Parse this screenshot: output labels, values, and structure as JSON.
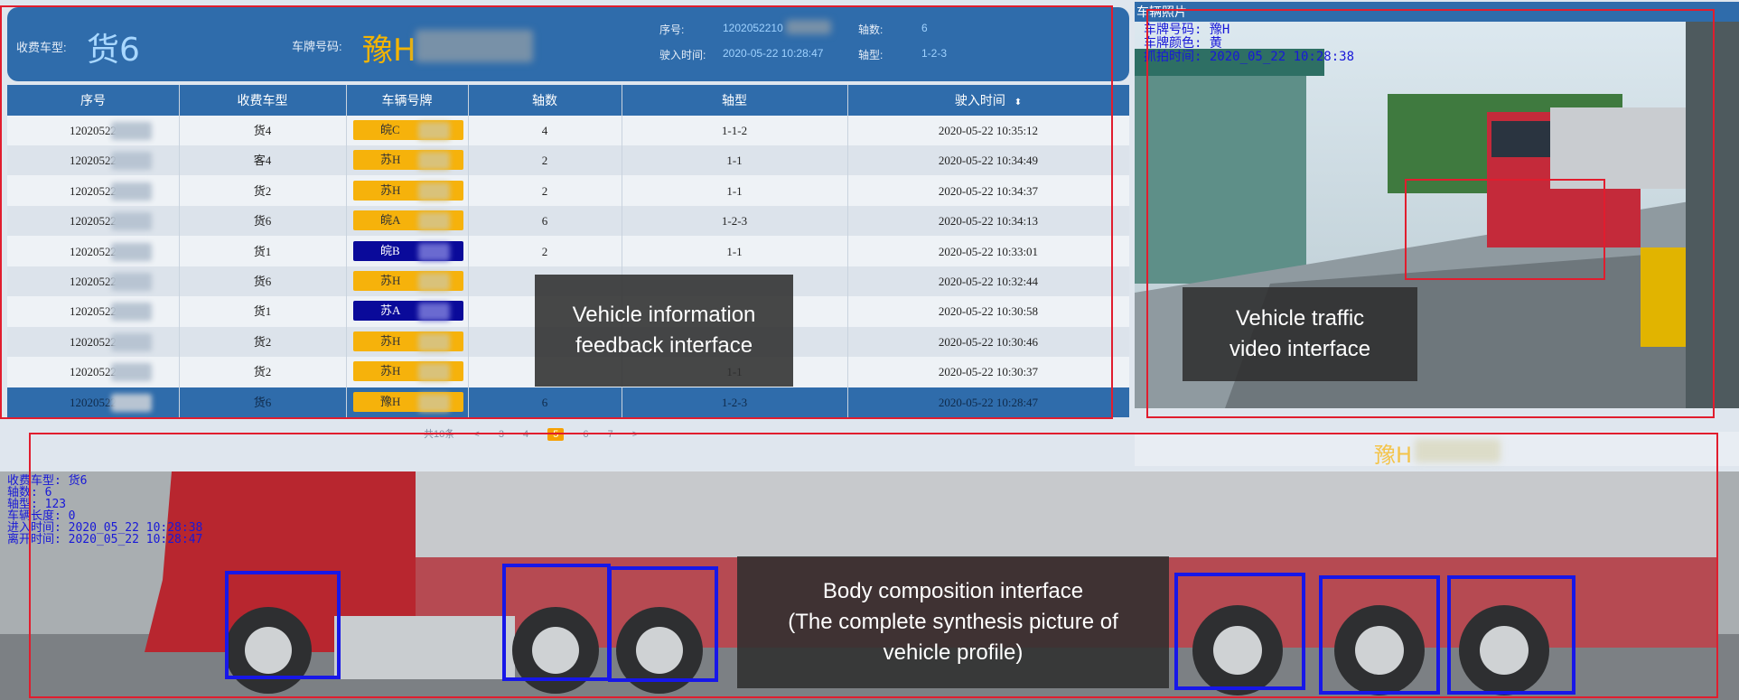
{
  "header": {
    "toll_type_label": "收费车型:",
    "toll_type_value": "货6",
    "plate_label": "车牌号码:",
    "plate_value": "豫H",
    "seq_label": "序号:",
    "seq_value": "1202052210",
    "axles_label": "轴数:",
    "axles_value": "6",
    "entry_time_label": "驶入时间:",
    "entry_time_value": "2020-05-22 10:28:47",
    "axle_type_label": "轴型:",
    "axle_type_value": "1-2-3"
  },
  "table": {
    "columns": [
      "序号",
      "收费车型",
      "车辆号牌",
      "轴数",
      "轴型",
      "驶入时间"
    ],
    "sort_icon": "sort-updown-icon",
    "rows": [
      {
        "seq": "12020522",
        "type": "货4",
        "plate": "皖C",
        "plate_color": "yellow",
        "axles": "4",
        "axle_type": "1-1-2",
        "time": "2020-05-22 10:35:12"
      },
      {
        "seq": "12020522",
        "type": "客4",
        "plate": "苏H",
        "plate_color": "yellow",
        "axles": "2",
        "axle_type": "1-1",
        "time": "2020-05-22 10:34:49"
      },
      {
        "seq": "12020522",
        "type": "货2",
        "plate": "苏H",
        "plate_color": "yellow",
        "axles": "2",
        "axle_type": "1-1",
        "time": "2020-05-22 10:34:37"
      },
      {
        "seq": "12020522",
        "type": "货6",
        "plate": "皖A",
        "plate_color": "yellow",
        "axles": "6",
        "axle_type": "1-2-3",
        "time": "2020-05-22 10:34:13"
      },
      {
        "seq": "12020522",
        "type": "货1",
        "plate": "皖B",
        "plate_color": "blue",
        "axles": "2",
        "axle_type": "1-1",
        "time": "2020-05-22 10:33:01"
      },
      {
        "seq": "12020522",
        "type": "货6",
        "plate": "苏H",
        "plate_color": "yellow",
        "axles": "",
        "axle_type": "",
        "time": "2020-05-22 10:32:44"
      },
      {
        "seq": "12020522",
        "type": "货1",
        "plate": "苏A",
        "plate_color": "blue",
        "axles": "",
        "axle_type": "",
        "time": "2020-05-22 10:30:58"
      },
      {
        "seq": "12020522",
        "type": "货2",
        "plate": "苏H",
        "plate_color": "yellow",
        "axles": "",
        "axle_type": "",
        "time": "2020-05-22 10:30:46"
      },
      {
        "seq": "12020522",
        "type": "货2",
        "plate": "苏H",
        "plate_color": "yellow",
        "axles": "",
        "axle_type": "1-1",
        "time": "2020-05-22 10:30:37"
      },
      {
        "seq": "12020522",
        "type": "货6",
        "plate": "豫H",
        "plate_color": "yellow",
        "axles": "6",
        "axle_type": "1-2-3",
        "time": "2020-05-22 10:28:47",
        "selected": true
      }
    ]
  },
  "pager": {
    "total_label": "共10条",
    "prev": "<",
    "pages": [
      "3",
      "4",
      "5",
      "6",
      "7"
    ],
    "active_page": "5",
    "next": ">"
  },
  "photo": {
    "title": "车辆照片",
    "info_line1": "车牌号码: 豫H",
    "info_line2": "车牌颜色: 黄",
    "info_line3": "抓拍时间: 2020_05_22 10:28:38"
  },
  "plate_strip": {
    "value": "豫H"
  },
  "body": {
    "info_lines": [
      "收费车型: 货6",
      "轴数: 6",
      "轴型: 123",
      "车辆长度: 0",
      "进入时间: 2020_05_22 10:28:38",
      "离开时间: 2020_05_22 10:28:47"
    ]
  },
  "captions": {
    "info": "Vehicle information\nfeedback interface",
    "video": "Vehicle traffic\nvideo interface",
    "body": "Body composition interface\n(The complete synthesis picture of\nvehicle profile)"
  },
  "colors": {
    "panel_blue": "#2f6cab",
    "plate_yellow": "#f6b20b",
    "plate_blue": "#0a0a9a",
    "annotation_red": "#e11d2e",
    "axle_box_blue": "#1717e8"
  }
}
